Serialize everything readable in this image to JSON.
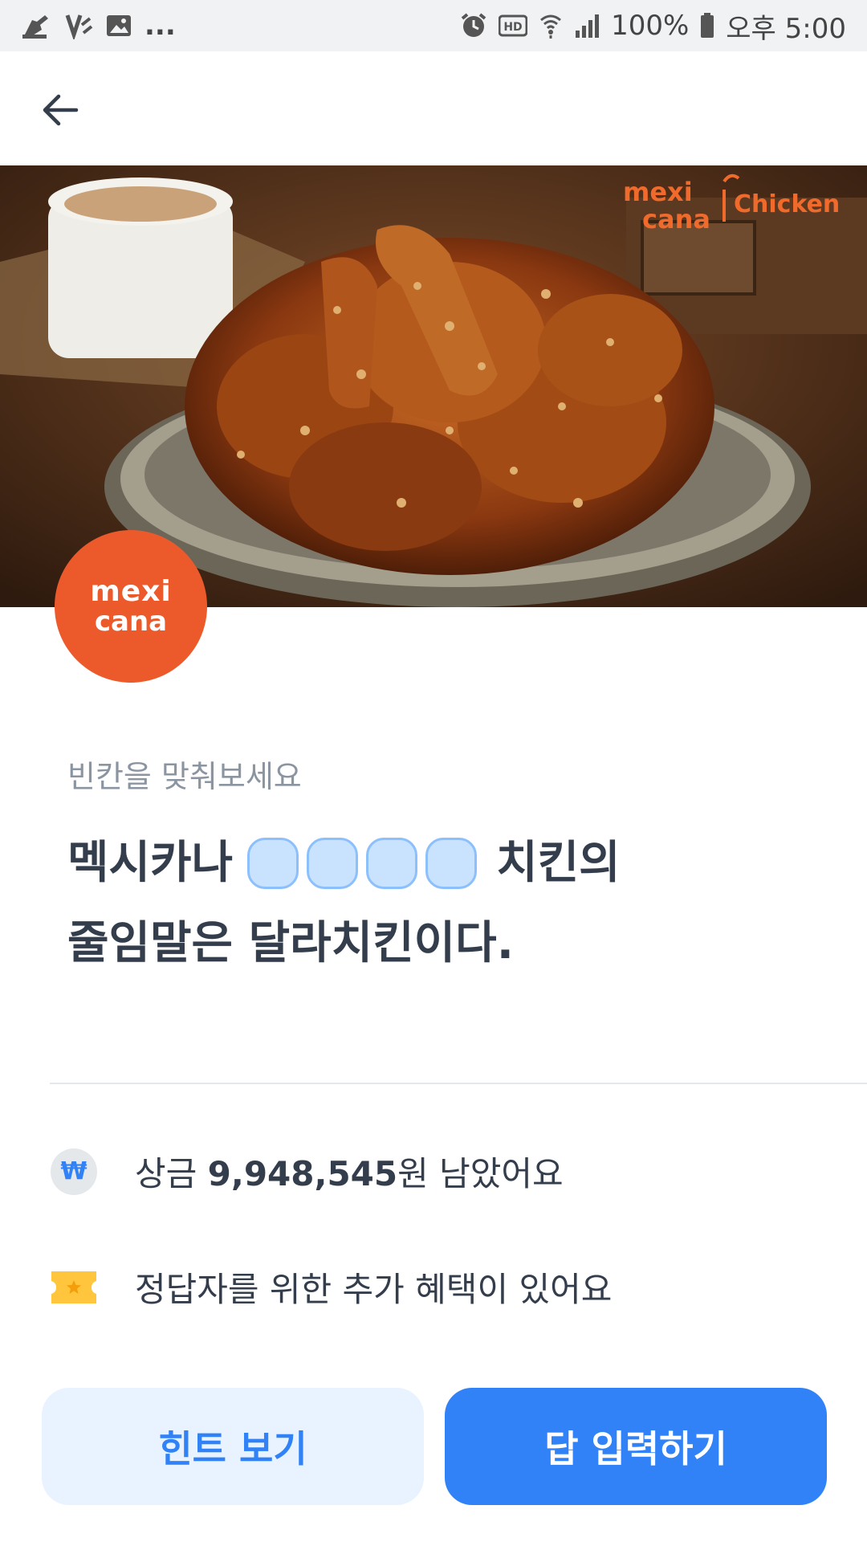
{
  "status_bar": {
    "notification_more": "...",
    "battery": "100%",
    "time": "오후 5:00"
  },
  "hero": {
    "brand_text_top": "mexi",
    "brand_text_bottom": "cana",
    "brand_text_chicken": "Chicken"
  },
  "brand_badge": {
    "line1": "mexi",
    "line2": "cana"
  },
  "quiz": {
    "prompt_label": "빈칸을 맞춰보세요",
    "line1_before": "멕시카나",
    "blank_count": 4,
    "line1_after": "치킨의",
    "line2": "줄임말은 달라치킨이다."
  },
  "info": {
    "prize_prefix": "상금 ",
    "prize_amount": "9,948,545",
    "prize_suffix": "원 남았어요",
    "coin_symbol": "₩",
    "bonus_text": "정답자를 위한 추가 혜택이 있어요"
  },
  "buttons": {
    "hint": "힌트 보기",
    "answer": "답 입력하기"
  },
  "colors": {
    "primary": "#3182f6",
    "primary_light": "#e8f3ff",
    "brand_orange": "#ec5a2c",
    "blank_fill": "#c9e2fe"
  },
  "icons": {
    "back": "arrow-left-icon",
    "coin": "won-coin-icon",
    "ticket": "ticket-icon"
  }
}
